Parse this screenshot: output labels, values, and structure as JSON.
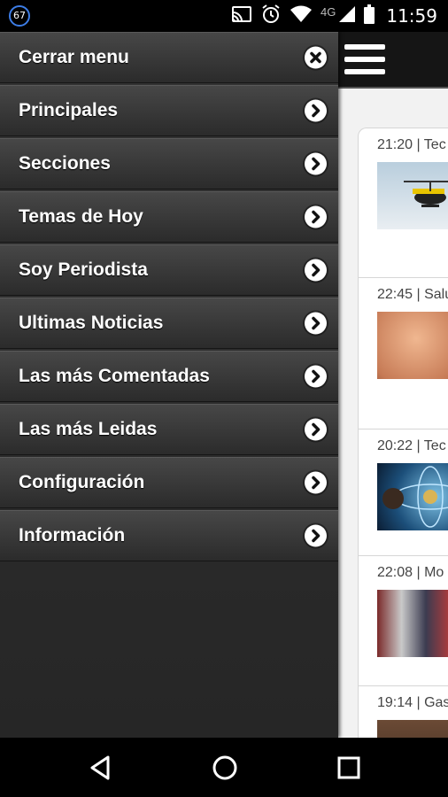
{
  "status_bar": {
    "notification_count": "67",
    "network": "4G",
    "time": "11:59",
    "icons": [
      "cast-icon",
      "alarm-icon",
      "wifi-icon",
      "signal-icon",
      "battery-icon"
    ]
  },
  "drawer": {
    "items": [
      {
        "label": "Cerrar menu",
        "icon": "close-icon"
      },
      {
        "label": "Principales",
        "icon": "chevron-right-icon"
      },
      {
        "label": "Secciones",
        "icon": "chevron-right-icon"
      },
      {
        "label": "Temas de Hoy",
        "icon": "chevron-right-icon"
      },
      {
        "label": "Soy Periodista",
        "icon": "chevron-right-icon"
      },
      {
        "label": "Ultimas Noticias",
        "icon": "chevron-right-icon"
      },
      {
        "label": "Las más Comentadas",
        "icon": "chevron-right-icon"
      },
      {
        "label": "Las más Leidas",
        "icon": "chevron-right-icon"
      },
      {
        "label": "Configuración",
        "icon": "chevron-right-icon"
      },
      {
        "label": "Información",
        "icon": "chevron-right-icon"
      }
    ]
  },
  "content": {
    "header_icon": "hamburger-menu-icon",
    "cards": [
      {
        "meta": "21:20 | Tec"
      },
      {
        "meta": "22:45 | Salu"
      },
      {
        "meta": "20:22 | Tec"
      },
      {
        "meta": "22:08 | Mo"
      },
      {
        "meta": "19:14 | Gas"
      }
    ]
  },
  "nav_bar": {
    "icons": [
      "back-icon",
      "home-icon",
      "recents-icon"
    ]
  }
}
